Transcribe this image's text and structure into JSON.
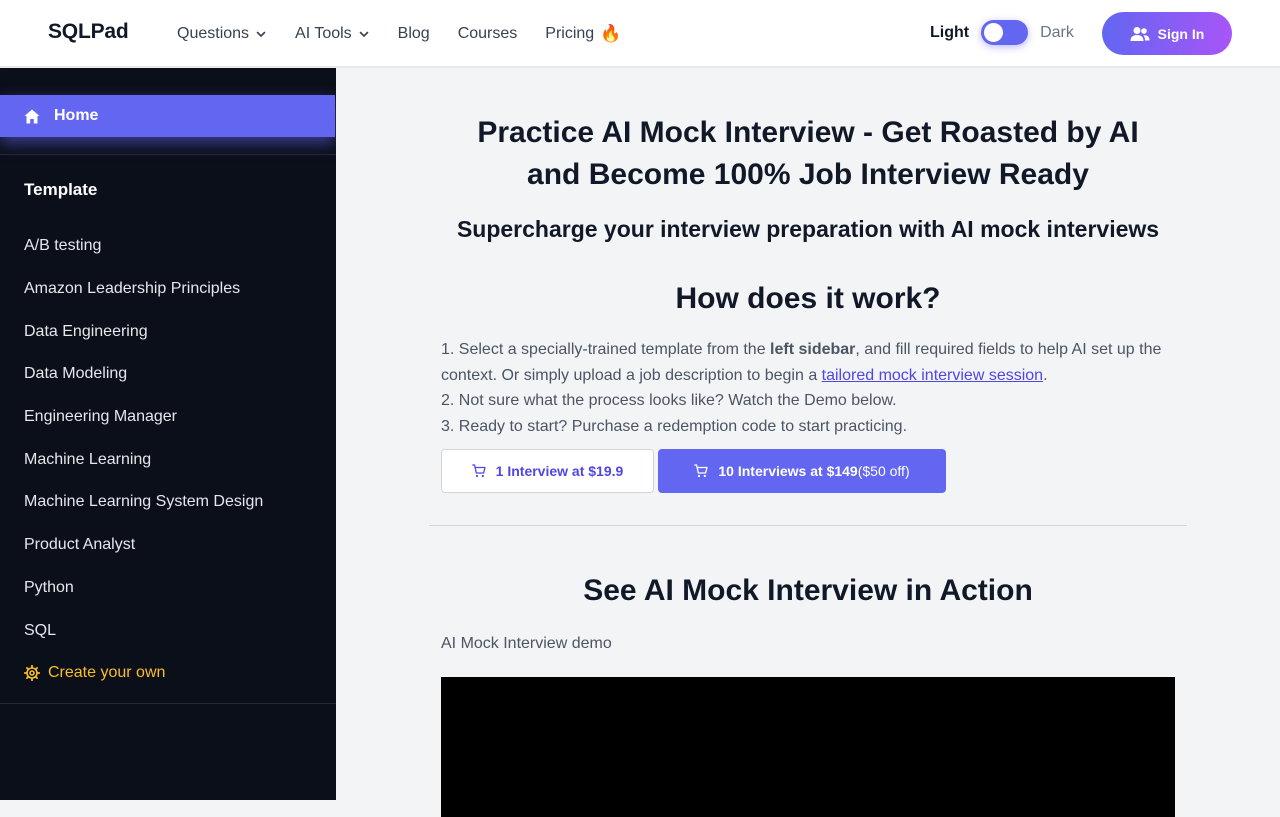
{
  "header": {
    "brand": "SQLPad",
    "nav": [
      {
        "label": "Questions",
        "dropdown": true
      },
      {
        "label": "AI Tools",
        "dropdown": true
      },
      {
        "label": "Blog",
        "dropdown": false
      },
      {
        "label": "Courses",
        "dropdown": false
      },
      {
        "label": "Pricing",
        "dropdown": false,
        "emoji": "🔥"
      }
    ],
    "theme_light": "Light",
    "theme_dark": "Dark",
    "sign_in": "Sign In"
  },
  "sidebar": {
    "home": "Home",
    "template_title": "Template",
    "items": [
      "A/B testing",
      "Amazon Leadership Principles",
      "Data Engineering",
      "Data Modeling",
      "Engineering Manager",
      "Machine Learning",
      "Machine Learning System Design",
      "Product Analyst",
      "Python",
      "SQL"
    ],
    "create": "Create your own"
  },
  "main": {
    "title_line1": "Practice AI Mock Interview - Get Roasted by AI",
    "title_line2": "and Become 100% Job Interview Ready",
    "subtitle": "Supercharge your interview preparation with AI mock interviews",
    "how_title": "How does it work?",
    "step1_a": "1. Select a specially-trained template from the ",
    "step1_bold": "left sidebar",
    "step1_b": ", and fill required fields to help AI set up the context. Or simply upload a job description to begin a ",
    "step1_link": "tailored mock interview session",
    "step1_c": ".",
    "step2": "2. Not sure what the process looks like? Watch the Demo below.",
    "step3": "3. Ready to start? Purchase a redemption code to start practicing.",
    "btn_one": "1 Interview at $19.9",
    "btn_ten_a": "10 Interviews at ",
    "btn_ten_price": "$149",
    "btn_ten_b": "($50 off)",
    "action_title": "See AI Mock Interview in Action",
    "demo_label": "AI Mock Interview demo"
  },
  "colors": {
    "accent": "#6366f1",
    "sidebar_bg": "#0b0f1a",
    "create_accent": "#fbbf24",
    "signin_gradient_end": "#a855f7"
  }
}
